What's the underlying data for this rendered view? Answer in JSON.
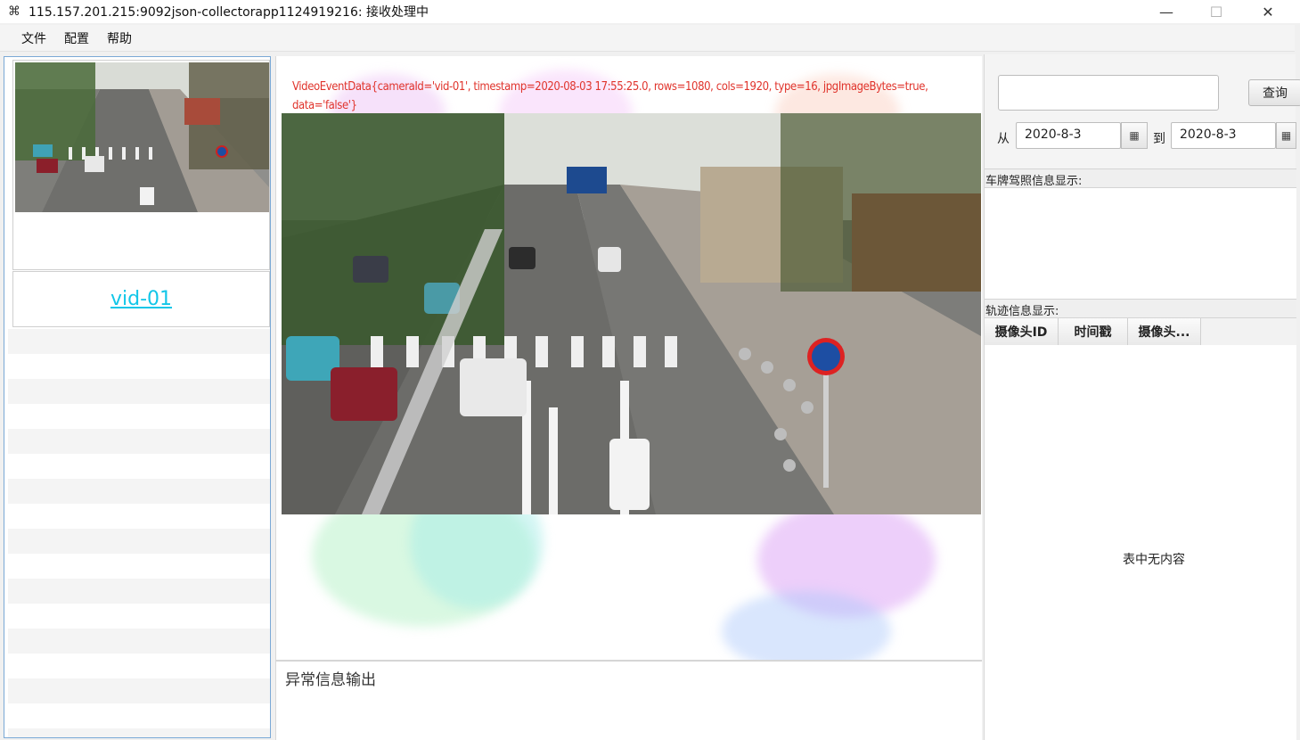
{
  "window": {
    "title": "115.157.201.215:9092json-collectorapp1124919216: 接收处理中",
    "app_icon": "kafka-logo-icon",
    "minimize_glyph": "—",
    "maximize_glyph": "☐",
    "close_glyph": "✕"
  },
  "menu": {
    "items": [
      "文件",
      "配置",
      "帮助"
    ]
  },
  "camera_list": {
    "items": [
      {
        "camera_label": "vid-01"
      }
    ]
  },
  "video": {
    "event_text": "VideoEventData{cameraId='vid-01', timestamp=2020-08-03 17:55:25.0, rows=1080, cols=1920, type=16, jpgImageBytes=true, data='false'}"
  },
  "error_panel": {
    "title": "异常信息输出"
  },
  "query": {
    "search_value": "",
    "query_button": "查询",
    "from_label": "从",
    "from_date": "2020-8-3",
    "to_label": "到",
    "to_date": "2020-8-3",
    "calendar_glyph": "▦"
  },
  "plate_section": {
    "header": "车牌驾照信息显示:"
  },
  "track_section": {
    "header": "轨迹信息显示:",
    "columns": [
      "摄像头ID",
      "时间戳",
      "摄像头..."
    ],
    "empty_text": "表中无内容"
  },
  "colors": {
    "link": "#12c6e8",
    "event_text": "#e0342c",
    "selection_border": "#7aa9d6"
  }
}
